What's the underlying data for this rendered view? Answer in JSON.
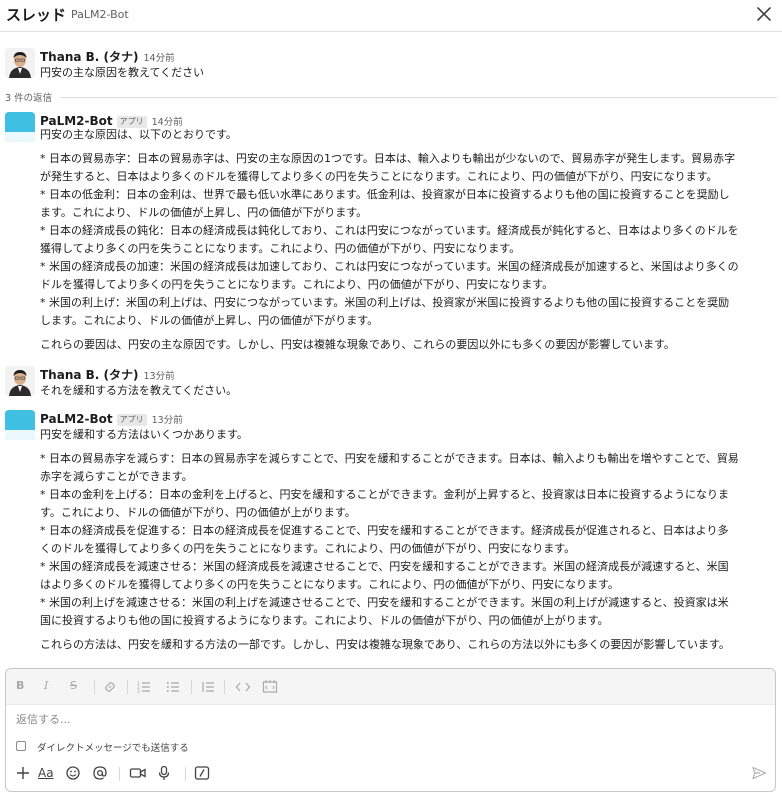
{
  "header": {
    "title": "スレッド",
    "channel": "PaLM2-Bot"
  },
  "replies_count": "3 件の返信",
  "messages": [
    {
      "name": "Thana B. (タナ)",
      "time": "14分前",
      "lines": [
        "円安の主な原因を教えてください"
      ]
    },
    {
      "name": "PaLM2-Bot",
      "badge": "アプリ",
      "time": "14分前",
      "lines": [
        "円安の主な原因は、以下のとおりです。",
        "",
        "* 日本の貿易赤字：日本の貿易赤字は、円安の主な原因の1つです。日本は、輸入よりも輸出が少ないので、貿易赤字が発生します。貿易赤字",
        "が発生すると、日本はより多くのドルを獲得してより多くの円を失うことになります。これにより、円の価値が下がり、円安になります。",
        "* 日本の低金利：日本の金利は、世界で最も低い水準にあります。低金利は、投資家が日本に投資するよりも他の国に投資することを奨励し",
        "ます。これにより、ドルの価値が上昇し、円の価値が下がります。",
        "* 日本の経済成長の鈍化：日本の経済成長は鈍化しており、これは円安につながっています。経済成長が鈍化すると、日本はより多くのドルを",
        "獲得してより多くの円を失うことになります。これにより、円の価値が下がり、円安になります。",
        "* 米国の経済成長の加速：米国の経済成長は加速しており、これは円安につながっています。米国の経済成長が加速すると、米国はより多くの",
        "ドルを獲得してより多くの円を失うことになります。これにより、円の価値が下がり、円安になります。",
        "* 米国の利上げ：米国の利上げは、円安につながっています。米国の利上げは、投資家が米国に投資するよりも他の国に投資することを奨励",
        "します。これにより、ドルの価値が上昇し、円の価値が下がります。",
        "",
        "これらの要因は、円安の主な原因です。しかし、円安は複雑な現象であり、これらの要因以外にも多くの要因が影響しています。"
      ]
    },
    {
      "name": "Thana B. (タナ)",
      "time": "13分前",
      "lines": [
        "それを緩和する方法を教えてください。"
      ]
    },
    {
      "name": "PaLM2-Bot",
      "badge": "アプリ",
      "time": "13分前",
      "lines": [
        "円安を緩和する方法はいくつかあります。",
        "",
        "* 日本の貿易赤字を減らす：日本の貿易赤字を減らすことで、円安を緩和することができます。日本は、輸入よりも輸出を増やすことで、貿易",
        "赤字を減らすことができます。",
        "* 日本の金利を上げる：日本の金利を上げると、円安を緩和することができます。金利が上昇すると、投資家は日本に投資するようになりま",
        "す。これにより、ドルの価値が下がり、円の価値が上がります。",
        "* 日本の経済成長を促進する：日本の経済成長を促進することで、円安を緩和することができます。経済成長が促進されると、日本はより多",
        "くのドルを獲得してより多くの円を失うことになります。これにより、円の価値が下がり、円安になります。",
        "* 米国の経済成長を減速させる：米国の経済成長を減速させることで、円安を緩和することができます。米国の経済成長が減速すると、米国",
        "はより多くのドルを獲得してより多くの円を失うことになります。これにより、円の価値が下がり、円安になります。",
        "* 米国の利上げを減速させる：米国の利上げを減速させることで、円安を緩和することができます。米国の利上げが減速すると、投資家は米",
        "国に投資するよりも他の国に投資するようになります。これにより、ドルの価値が下がり、円の価値が上がります。",
        "",
        "これらの方法は、円安を緩和する方法の一部です。しかし、円安は複雑な現象であり、これらの方法以外にも多くの要因が影響しています。"
      ]
    }
  ],
  "composer": {
    "placeholder": "返信する...",
    "dm_label": "ダイレクトメッセージでも送信する",
    "toolbar": {
      "bold": "B",
      "italic": "I",
      "strike": "S"
    },
    "bottom": {
      "format": "Aa"
    }
  },
  "icons": {
    "close": "close-icon",
    "link": "link-icon",
    "ordered_list": "ordered-list-icon",
    "bullet_list": "bullet-list-icon",
    "blockquote": "blockquote-icon",
    "code": "code-icon",
    "code_block": "code-block-icon",
    "plus": "plus-icon",
    "emoji": "emoji-icon",
    "mention": "mention-icon",
    "video": "video-icon",
    "microphone": "microphone-icon",
    "slash": "slash-command-icon",
    "send": "send-icon"
  },
  "colors": {
    "bot_avatar": "#3fbfe2",
    "text": "#1d1c1d",
    "muted": "#616061"
  }
}
